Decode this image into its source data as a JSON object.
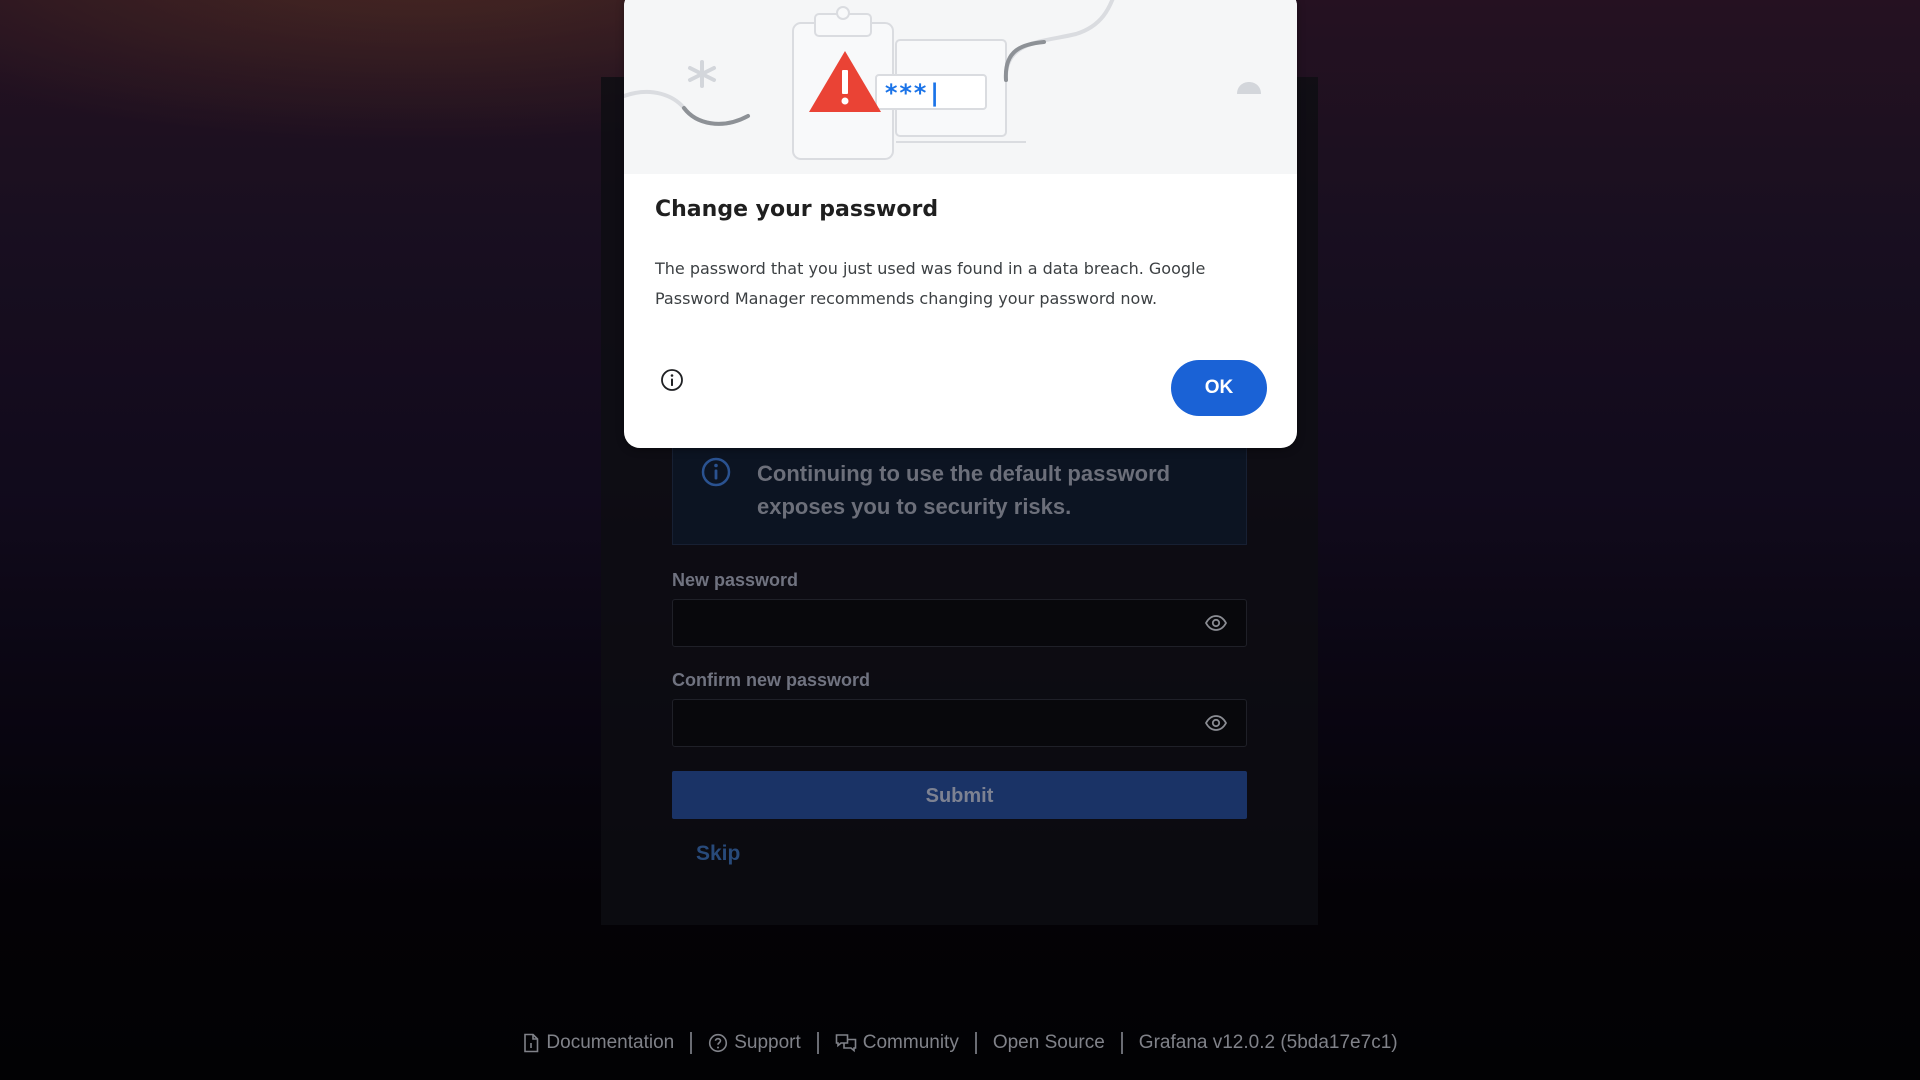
{
  "login": {
    "alert_text": "Continuing to use the default password exposes you to security risks.",
    "new_password_label": "New password",
    "confirm_password_label": "Confirm new password",
    "submit_label": "Submit",
    "skip_label": "Skip"
  },
  "footer": {
    "links": [
      "Documentation",
      "Support",
      "Community",
      "Open Source",
      "Grafana v12.0.2 (5bda17e7c1)"
    ]
  },
  "dialog": {
    "title": "Change your password",
    "body": "The password that you just used was found in a data breach. Google Password Manager recommends changing your password now.",
    "ok_label": "OK",
    "illustration_text": "***|"
  },
  "colors": {
    "accent": "#1a62d6",
    "warning": "#ea4335",
    "submit_bg": "#1a3366"
  }
}
